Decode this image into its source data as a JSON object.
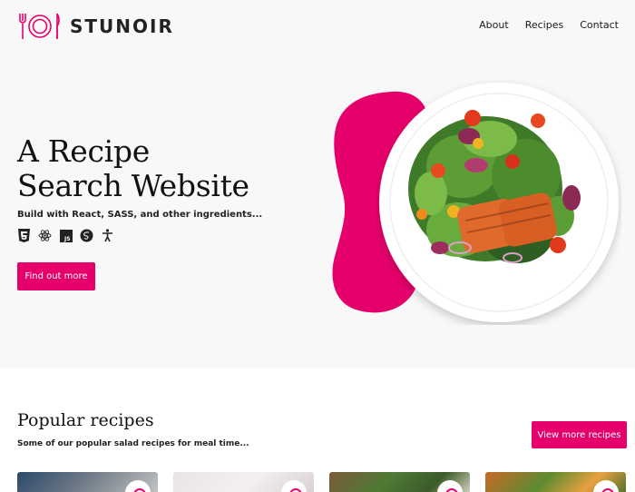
{
  "brand": {
    "name": "STUNOIR",
    "accent": "#e6006b"
  },
  "nav": {
    "items": [
      "About",
      "Recipes",
      "Contact"
    ]
  },
  "hero": {
    "title_line1": "A Recipe",
    "title_line2": "Search Website",
    "subtitle": "Build with React, SASS, and other ingredients...",
    "tech_icons": [
      "html5-icon",
      "react-icon",
      "javascript-icon",
      "sass-icon",
      "accessibility-icon"
    ],
    "cta_label": "Find out more"
  },
  "popular": {
    "title": "Popular recipes",
    "subtitle": "Some of our popular salad recipes for meal time...",
    "more_label": "View more recipes",
    "cards": [
      {
        "name": "recipe-card-1"
      },
      {
        "name": "recipe-card-2"
      },
      {
        "name": "recipe-card-3"
      },
      {
        "name": "recipe-card-4"
      }
    ]
  }
}
